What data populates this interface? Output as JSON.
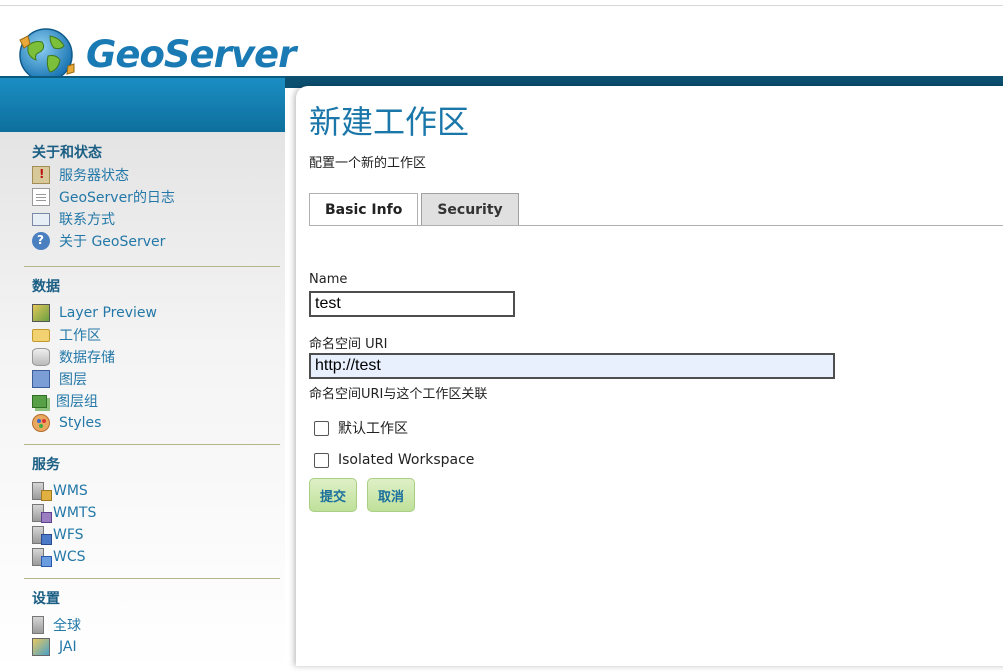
{
  "logo": {
    "text": "GeoServer"
  },
  "sidebar": {
    "sections": [
      {
        "title": "关于和状态",
        "items": [
          {
            "label": "服务器状态",
            "icon": "server-status-icon"
          },
          {
            "label": "GeoServer的日志",
            "icon": "log-document-icon"
          },
          {
            "label": "联系方式",
            "icon": "contact-card-icon"
          },
          {
            "label": "关于 GeoServer",
            "icon": "info-icon"
          }
        ]
      },
      {
        "title": "数据",
        "items": [
          {
            "label": "Layer Preview",
            "icon": "map-preview-icon"
          },
          {
            "label": "工作区",
            "icon": "folder-icon"
          },
          {
            "label": "数据存储",
            "icon": "database-icon"
          },
          {
            "label": "图层",
            "icon": "layer-icon"
          },
          {
            "label": "图层组",
            "icon": "layer-group-icon"
          },
          {
            "label": "Styles",
            "icon": "palette-icon"
          }
        ]
      },
      {
        "title": "服务",
        "items": [
          {
            "label": "WMS",
            "icon": "wms-server-icon"
          },
          {
            "label": "WMTS",
            "icon": "wmts-server-icon"
          },
          {
            "label": "WFS",
            "icon": "wfs-server-icon"
          },
          {
            "label": "WCS",
            "icon": "wcs-server-icon"
          }
        ]
      },
      {
        "title": "设置",
        "items": [
          {
            "label": "全球",
            "icon": "global-settings-icon"
          },
          {
            "label": "JAI",
            "icon": "jai-icon"
          }
        ]
      }
    ]
  },
  "main": {
    "title": "新建工作区",
    "description": "配置一个新的工作区",
    "tabs": [
      {
        "label": "Basic Info",
        "active": true
      },
      {
        "label": "Security",
        "active": false
      }
    ],
    "form": {
      "name_label": "Name",
      "name_value": "test",
      "uri_label": "命名空间 URI",
      "uri_value": "http://test",
      "uri_hint": "命名空间URI与这个工作区关联",
      "default_label": "默认工作区",
      "default_checked": false,
      "isolated_label": "Isolated Workspace",
      "isolated_checked": false
    },
    "buttons": {
      "submit": "提交",
      "cancel": "取消"
    }
  },
  "colors": {
    "brand_blue": "#1b77a9",
    "header_dark": "#0b4f71",
    "button_green": "#bfe09a"
  }
}
